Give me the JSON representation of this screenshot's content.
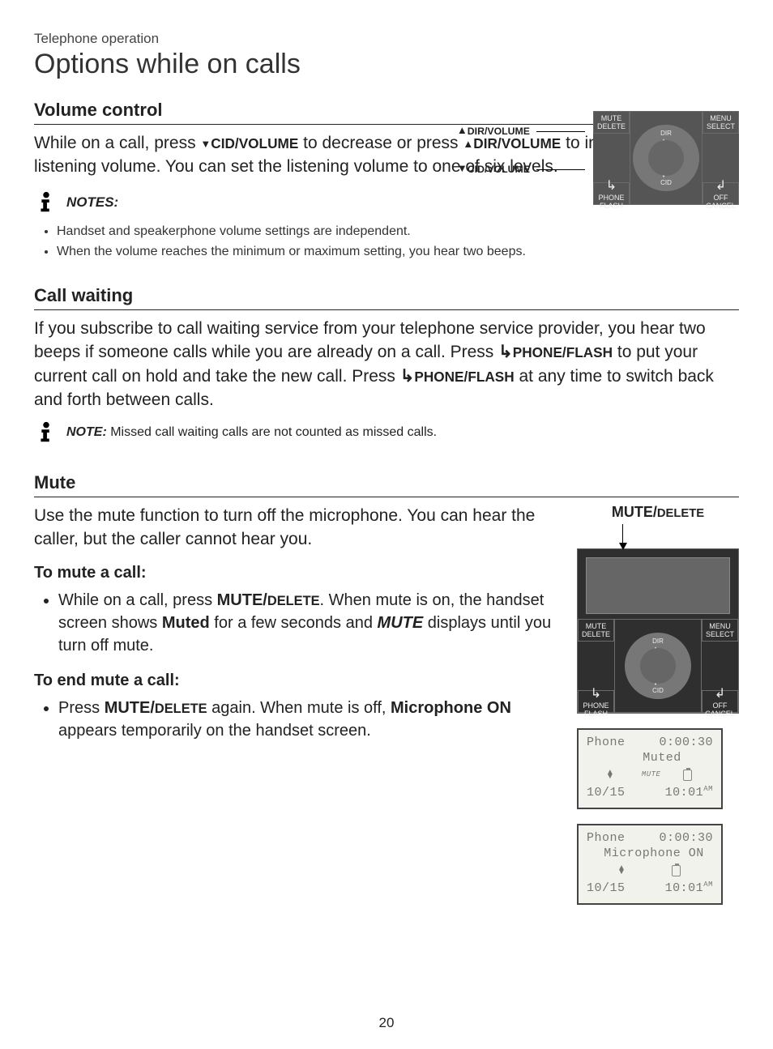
{
  "breadcrumb": "Telephone operation",
  "title": "Options while on calls",
  "section1": {
    "heading": "Volume control",
    "body_pre": "While on a call, press ",
    "btn_down": "CID/VOLUME",
    "body_mid": " to decrease or press ",
    "btn_up": "DIR/VOLUME",
    "body_end": " to increase the listening volume. You can set the listening volume to one of six levels.",
    "callout_up": "DIR/VOLUME",
    "callout_down": "CID/VOLUME",
    "notes_label": "NOTES:",
    "notes": [
      "Handset and speakerphone volume settings are independent.",
      "When the volume reaches the minimum or maximum setting, you hear two beeps."
    ]
  },
  "section2": {
    "heading": "Call waiting",
    "body_pre": "If you subscribe to call waiting service from your telephone service provider, you hear two beeps if someone calls while you are already on a call. Press ",
    "btn": "PHONE/FLASH",
    "body_mid": " to put your current call on hold and take the new call. Press ",
    "body_end": " at any time to switch back and forth between calls.",
    "note_label": "NOTE:",
    "note_text": " Missed call waiting calls are not counted as missed calls."
  },
  "section3": {
    "heading": "Mute",
    "intro": "Use the mute function to turn off the microphone. You can hear the caller, but the caller cannot hear you.",
    "sub1": "To mute a call:",
    "step1_pre": "While on a call, press ",
    "step1_btn": "MUTE/DELETE",
    "step1_mid": ". When mute is on, the handset screen shows ",
    "step1_word": "Muted",
    "step1_mid2": " for a few seconds and ",
    "step1_word2": "MUTE",
    "step1_end": "  displays until you turn off mute.",
    "sub2": "To end mute a call:",
    "step2_pre": "Press ",
    "step2_btn": "MUTE/DELETE",
    "step2_mid": " again. When mute is off, ",
    "step2_word": "Microphone ON",
    "step2_end": " appears temporarily on the handset screen.",
    "callout": "MUTE/DELETE"
  },
  "keypad": {
    "mute": "MUTE",
    "delete": "DELETE",
    "menu": "MENU",
    "select": "SELECT",
    "phone": "PHONE",
    "flash": "FLASH",
    "off": "OFF",
    "cancel": "CANCEL",
    "dir": "DIR",
    "volume": "VOLUME",
    "cid": "CID"
  },
  "lcd1": {
    "line1a": "Phone",
    "line1b": "0:00:30",
    "line2": "Muted",
    "mute_tag": "MUTE",
    "date": "10/15",
    "time": "10:01",
    "ampm": "AM"
  },
  "lcd2": {
    "line1a": "Phone",
    "line1b": "0:00:30",
    "line2": "Microphone ON",
    "date": "10/15",
    "time": "10:01",
    "ampm": "AM"
  },
  "page_number": "20"
}
